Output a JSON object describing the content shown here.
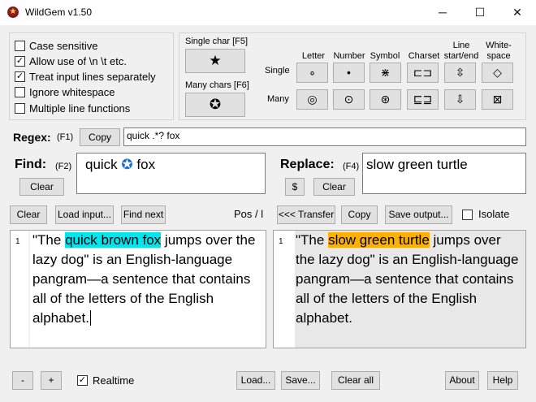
{
  "window": {
    "title": "WildGem v1.50",
    "minimize": "─",
    "maximize": "☐",
    "close": "✕"
  },
  "options": [
    {
      "label": "Case sensitive",
      "checked": false
    },
    {
      "label": "Allow use of \\n \\t etc.",
      "checked": true
    },
    {
      "label": "Treat input lines separately",
      "checked": true
    },
    {
      "label": "Ignore whitespace",
      "checked": false
    },
    {
      "label": "Multiple line functions",
      "checked": false
    }
  ],
  "wildcards": {
    "single_char_label": "Single char [F5]",
    "single_char_symbol": "★",
    "many_chars_label": "Many chars [F6]",
    "many_chars_symbol": "✪",
    "col_letter": "Letter",
    "col_number": "Number",
    "col_symbol": "Symbol",
    "col_charset": "Charset",
    "col_line_1": "Line",
    "col_line_2": "start/end",
    "col_white_1": "White-",
    "col_white_2": "space",
    "row_single": "Single",
    "row_many": "Many",
    "single_syms": [
      "∘",
      "•",
      "⋇",
      "⊏⊐",
      "⇳",
      "◇"
    ],
    "many_syms": [
      "◎",
      "⊙",
      "⊛",
      "⊑⊒",
      "⇩",
      "⊠"
    ]
  },
  "regex": {
    "label": "Regex:",
    "key": "(F1)",
    "copy": "Copy",
    "value": "quick .*? fox"
  },
  "find": {
    "label": "Find:",
    "key": "(F2)",
    "clear": "Clear",
    "value_pre": "quick ",
    "value_icon": "✪",
    "value_post": " fox"
  },
  "replace": {
    "label": "Replace:",
    "key": "(F4)",
    "dollar": "$",
    "clear": "Clear",
    "value": "slow green turtle"
  },
  "input_toolbar": {
    "clear": "Clear",
    "load": "Load input...",
    "find_next": "Find next",
    "pos": "Pos / l"
  },
  "output_toolbar": {
    "transfer": "<<< Transfer",
    "copy": "Copy",
    "save": "Save output...",
    "isolate": "Isolate",
    "isolate_checked": false
  },
  "input_text": {
    "line_no": "1",
    "pre": "\"The ",
    "match": "quick brown fox",
    "post": " jumps over the lazy dog\" is an English-language pangram—a sentence that contains all of the letters of the English alphabet."
  },
  "output_text": {
    "line_no": "1",
    "pre": "\"The ",
    "match": "slow green turtle",
    "post": " jumps over the lazy dog\" is an English-language pangram—a sentence that contains all of the letters of the English alphabet."
  },
  "bottom": {
    "minus": "-",
    "plus": "+",
    "realtime": "Realtime",
    "realtime_checked": true,
    "load": "Load...",
    "save": "Save...",
    "clear_all": "Clear all",
    "about": "About",
    "help": "Help"
  },
  "colors": {
    "find_highlight": "#00e5ee",
    "replace_highlight": "#ffb000"
  }
}
